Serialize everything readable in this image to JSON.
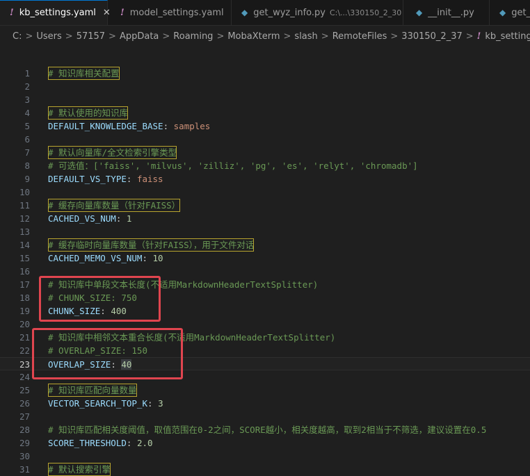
{
  "tabs": [
    {
      "icon": "!",
      "label": "kb_settings.yaml",
      "path": "",
      "close": "✕"
    },
    {
      "icon": "!",
      "label": "model_settings.yaml",
      "path": ""
    },
    {
      "icon": "py",
      "label": "get_wyz_info.py",
      "path": "C:\\...\\330150_2_30"
    },
    {
      "icon": "py",
      "label": "__init__.py",
      "path": ""
    },
    {
      "icon": "py",
      "label": "get_",
      "path": ""
    }
  ],
  "breadcrumb": [
    "C:",
    "Users",
    "57157",
    "AppData",
    "Roaming",
    "MobaXterm",
    "slash",
    "RemoteFiles",
    "330150_2_37",
    "kb_settings.yaml"
  ],
  "breadcrumb_sep": ">",
  "lines": {
    "l1": {
      "n": "1",
      "comment": "# 知识库相关配置"
    },
    "l2": {
      "n": "2"
    },
    "l3": {
      "n": "3"
    },
    "l4": {
      "n": "4",
      "comment": "# 默认使用的知识库"
    },
    "l5": {
      "n": "5",
      "key": "DEFAULT_KNOWLEDGE_BASE",
      "value": "samples"
    },
    "l6": {
      "n": "6"
    },
    "l7": {
      "n": "7",
      "comment": "# 默认向量库/全文检索引擎类型"
    },
    "l8": {
      "n": "8",
      "comment": "# 可选值：['faiss', 'milvus', 'zilliz', 'pg', 'es', 'relyt', 'chromadb']"
    },
    "l9": {
      "n": "9",
      "key": "DEFAULT_VS_TYPE",
      "value": "faiss"
    },
    "l10": {
      "n": "10"
    },
    "l11": {
      "n": "11",
      "comment": "# 缓存向量库数量（针对FAISS）"
    },
    "l12": {
      "n": "12",
      "key": "CACHED_VS_NUM",
      "value": "1"
    },
    "l13": {
      "n": "13"
    },
    "l14": {
      "n": "14",
      "comment": "# 缓存临时向量库数量（针对FAISS），用于文件对话"
    },
    "l15": {
      "n": "15",
      "key": "CACHED_MEMO_VS_NUM",
      "value": "10"
    },
    "l16": {
      "n": "16"
    },
    "l17": {
      "n": "17",
      "comment": "# 知识库中单段文本长度(不适用MarkdownHeaderTextSplitter)"
    },
    "l18": {
      "n": "18",
      "comment": "# CHUNK_SIZE: 750"
    },
    "l19": {
      "n": "19",
      "key": "CHUNK_SIZE",
      "value": "400"
    },
    "l20": {
      "n": "20"
    },
    "l21": {
      "n": "21",
      "comment": "# 知识库中相邻文本重合长度(不适用MarkdownHeaderTextSplitter)"
    },
    "l22": {
      "n": "22",
      "comment": "# OVERLAP_SIZE: 150"
    },
    "l23": {
      "n": "23",
      "key": "OVERLAP_SIZE",
      "value": "40"
    },
    "l24": {
      "n": "24"
    },
    "l25": {
      "n": "25",
      "comment": "# 知识库匹配向量数量"
    },
    "l26": {
      "n": "26",
      "key": "VECTOR_SEARCH_TOP_K",
      "value": "3"
    },
    "l27": {
      "n": "27"
    },
    "l28": {
      "n": "28",
      "comment": "# 知识库匹配相关度阈值，取值范围在0-2之间，SCORE越小，相关度越高，取到2相当于不筛选，建议设置在0.5"
    },
    "l29": {
      "n": "29",
      "key": "SCORE_THRESHOLD",
      "value": "2.0"
    },
    "l30": {
      "n": "30"
    },
    "l31": {
      "n": "31",
      "comment": "# 默认搜索引擎"
    }
  },
  "colors": {
    "background": "#1f1f1f",
    "comment": "#6a9955",
    "key": "#9cdcfe",
    "string": "#ce9178",
    "number": "#b5cea8",
    "annotation_box": "#e0454f",
    "yaml_icon": "#c586c0",
    "python_icon": "#519aba"
  }
}
